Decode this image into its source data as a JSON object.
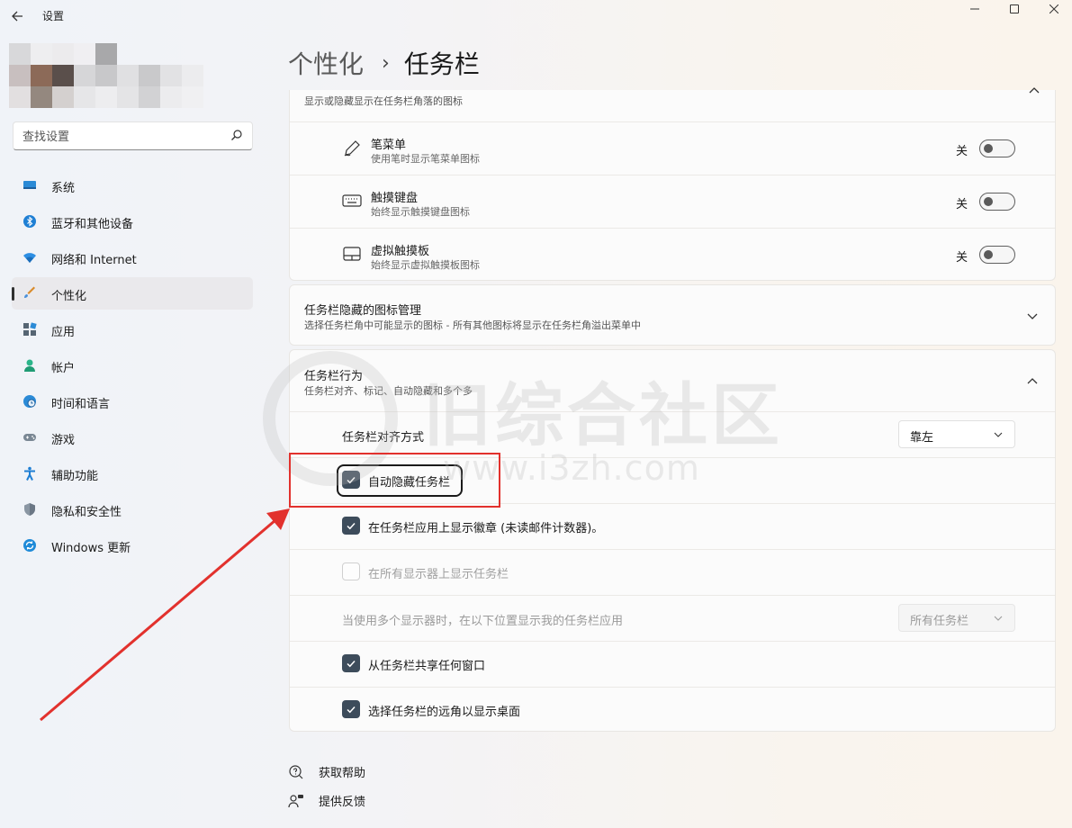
{
  "app": {
    "title": "设置"
  },
  "search": {
    "placeholder": "查找设置"
  },
  "sidebar": {
    "items": [
      {
        "label": "系统",
        "icon": "monitor-icon"
      },
      {
        "label": "蓝牙和其他设备",
        "icon": "bluetooth-icon"
      },
      {
        "label": "网络和 Internet",
        "icon": "wifi-icon"
      },
      {
        "label": "个性化",
        "icon": "brush-icon",
        "active": true
      },
      {
        "label": "应用",
        "icon": "apps-icon"
      },
      {
        "label": "帐户",
        "icon": "account-icon"
      },
      {
        "label": "时间和语言",
        "icon": "globe-clock-icon"
      },
      {
        "label": "游戏",
        "icon": "gamepad-icon"
      },
      {
        "label": "辅助功能",
        "icon": "accessibility-icon"
      },
      {
        "label": "隐私和安全性",
        "icon": "shield-icon"
      },
      {
        "label": "Windows 更新",
        "icon": "update-icon"
      }
    ]
  },
  "breadcrumb": {
    "parent": "个性化",
    "current": "任务栏"
  },
  "corner_icons": {
    "description": "显示或隐藏显示在任务栏角落的图标",
    "rows": [
      {
        "title": "笔菜单",
        "desc": "使用笔时显示笔菜单图标",
        "state": "关",
        "icon": "pen-icon"
      },
      {
        "title": "触摸键盘",
        "desc": "始终显示触摸键盘图标",
        "state": "关",
        "icon": "keyboard-icon"
      },
      {
        "title": "虚拟触摸板",
        "desc": "始终显示虚拟触摸板图标",
        "state": "关",
        "icon": "touchpad-icon"
      }
    ]
  },
  "overflow": {
    "title": "任务栏隐藏的图标管理",
    "desc": "选择任务栏角中可能显示的图标 - 所有其他图标将显示在任务栏角溢出菜单中"
  },
  "behaviors": {
    "title": "任务栏行为",
    "desc": "任务栏对齐、标记、自动隐藏和多个多",
    "alignment_label": "任务栏对齐方式",
    "alignment_value": "靠左",
    "autohide_label": "自动隐藏任务栏",
    "badges_label": "在任务栏应用上显示徽章 (未读邮件计数器)。",
    "all_displays_label": "在所有显示器上显示任务栏",
    "multi_display_label": "当使用多个显示器时，在以下位置显示我的任务栏应用",
    "multi_display_value": "所有任务栏",
    "share_label": "从任务栏共享任何窗口",
    "corner_label": "选择任务栏的远角以显示桌面"
  },
  "footer": {
    "help": "获取帮助",
    "feedback": "提供反馈"
  },
  "watermark": {
    "line1": "旧综合社区",
    "line2": "www.i3zh.com"
  },
  "colors": {
    "accent": "#3d4c5b",
    "highlight": "#e2312d"
  }
}
